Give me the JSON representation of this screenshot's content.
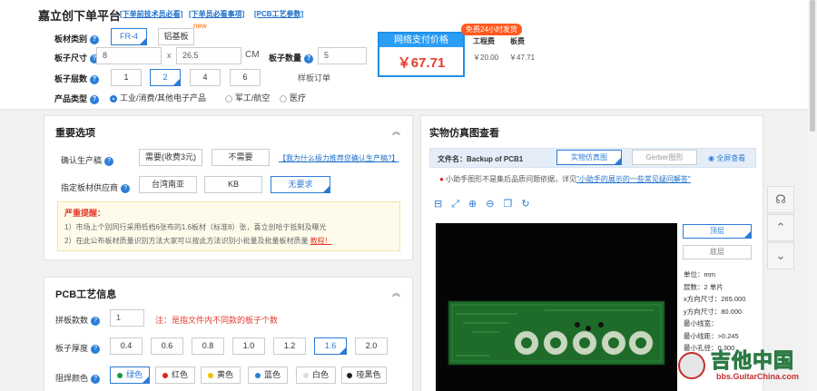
{
  "header": {
    "title": "嘉立创下单平台",
    "links": [
      "[下单前技术员必看]",
      "[下单员必看事项]",
      "[PCB工艺参数]"
    ]
  },
  "board_type": {
    "label": "板材类别",
    "options": [
      "FR-4",
      "铝基板"
    ],
    "new_badge": "new"
  },
  "board_size": {
    "label": "板子尺寸",
    "width": "8",
    "x": "x",
    "height": "26.5",
    "unit": "CM"
  },
  "board_qty": {
    "label": "板子数量",
    "value": "5",
    "note": "样板订单"
  },
  "layers": {
    "label": "板子层数",
    "options": [
      "1",
      "2",
      "4",
      "6"
    ]
  },
  "product": {
    "label": "产品类型",
    "options": [
      "工业/消费/其他电子产品",
      "军工/航空",
      "医疗"
    ]
  },
  "price": {
    "badge": "免费24小时发货",
    "title": "网络支付价格",
    "amount": "￥67.71",
    "eng_label": "工程费",
    "eng_value": "￥20.00",
    "board_label": "板费",
    "board_value": "￥47.71"
  },
  "important": {
    "title": "重要选项",
    "confirm_label": "确认生产稿",
    "confirm_options": [
      "需要(收费3元)",
      "不需要"
    ],
    "confirm_link": "【我为什么极力推荐您确认生产稿?】",
    "supplier_label": "指定板材供应商",
    "supplier_options": [
      "台湾南亚",
      "KB",
      "无要求"
    ],
    "notice_title": "严重提醒：",
    "notice_1": "1）市场上个别同行采用低档6张布的1.6板材（标准8）张，喜立创哈于抵制及曝光",
    "notice_2": "2）在此公布板材质量识别方法大家可以按此方法识别小批量及批量板材质量",
    "notice_link": "教程！"
  },
  "craft": {
    "title": "PCB工艺信息",
    "panel_label": "拼板款数",
    "panel_value": "1",
    "panel_note": "注：是指文件内不同款的板子个数",
    "thick_label": "板子厚度",
    "thick_options": [
      "0.4",
      "0.6",
      "0.8",
      "1.0",
      "1.2",
      "1.6",
      "2.0"
    ],
    "mask_label": "阻焊颜色",
    "mask_options": [
      "绿色",
      "红色",
      "黄色",
      "蓝色",
      "白色",
      "哑黑色"
    ],
    "mask_colors": [
      "#1a9a3a",
      "#e02020",
      "#f0c000",
      "#2b7bd6",
      "#dddddd",
      "#222222"
    ]
  },
  "viewer": {
    "title": "实物仿真图查看",
    "file_label": "文件名：Backup of PCB1",
    "tab_sim": "实物仿真图",
    "tab_gerber": "Gerber图形",
    "fullscreen": "全屏查看",
    "tip": "小助手图形不是集后品质问题依据，详见",
    "tip_link": "\"小助手的展示的一些常见疑问解答\"",
    "top_btn": "顶层",
    "bottom_btn": "底层",
    "info": [
      "单位：mm",
      "层数：2    单片",
      "x方向尺寸：265.000",
      "y方向尺寸：80.000",
      "最小线宽：",
      "最小线距：>0.245",
      "最小孔径：0.300"
    ]
  },
  "watermark": {
    "text": "吉他中国",
    "url": "bbs.GuitarChina.com"
  }
}
